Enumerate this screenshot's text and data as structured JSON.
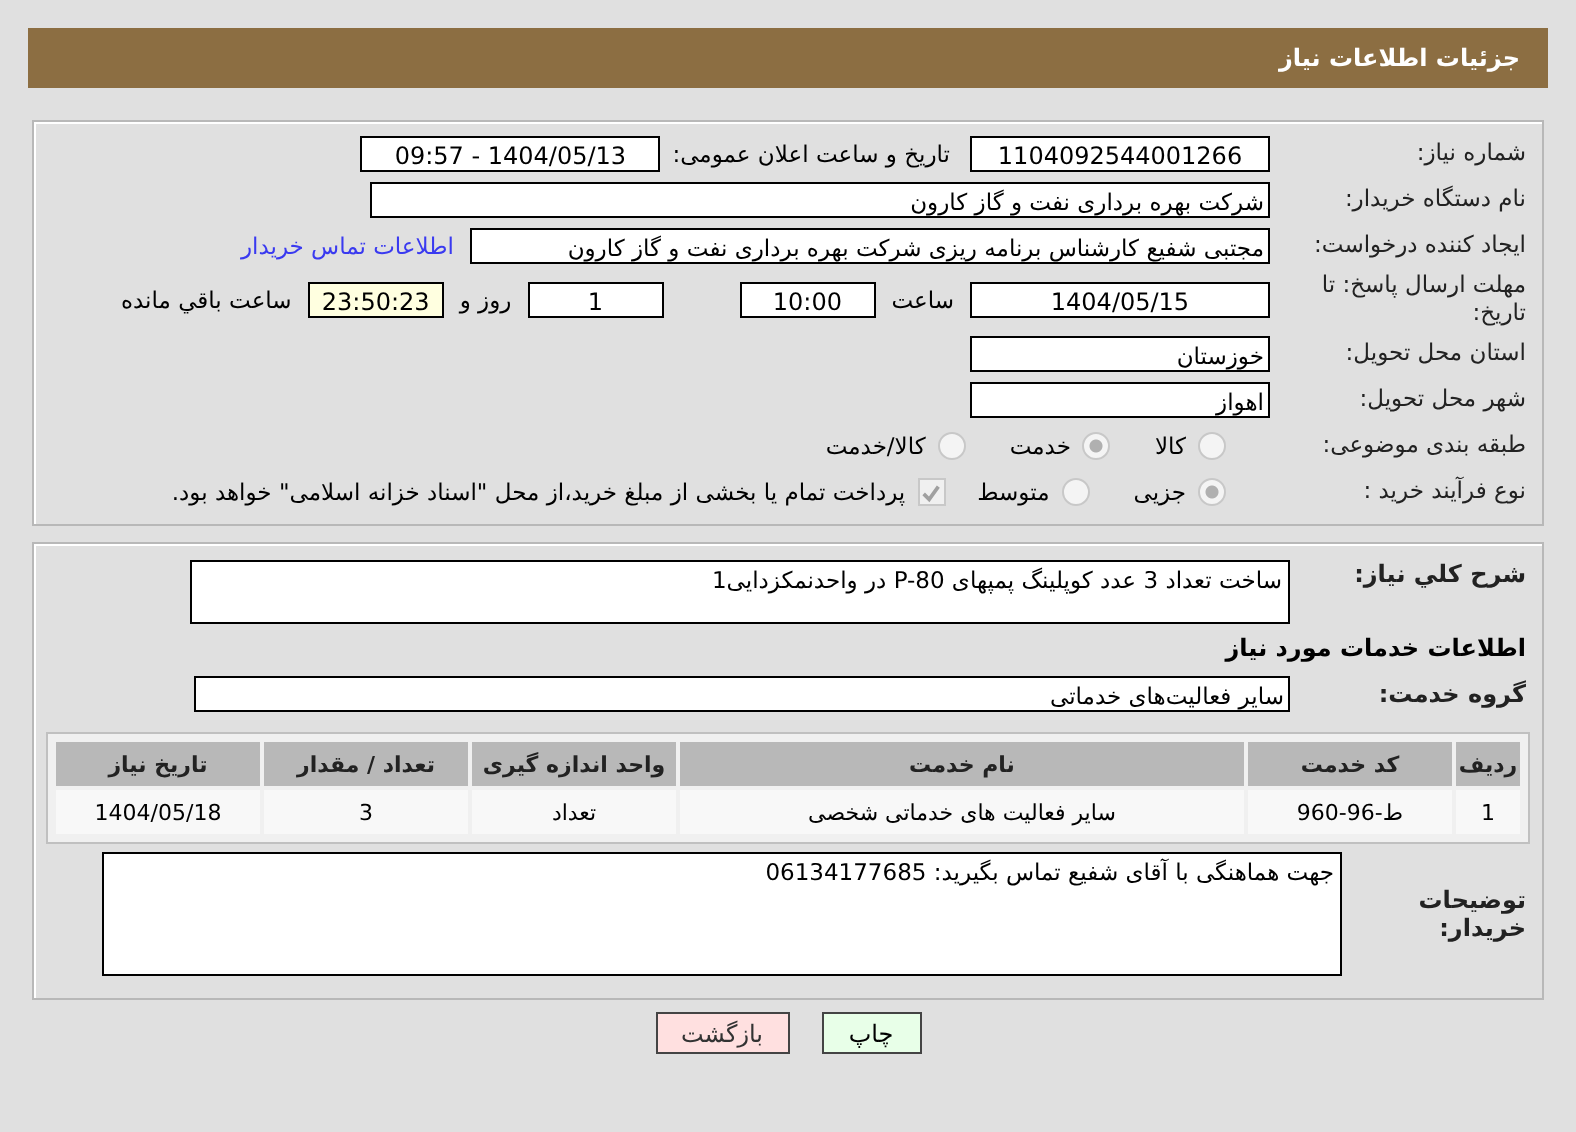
{
  "header": {
    "title": "جزئیات اطلاعات نیاز"
  },
  "need_number": {
    "label": "شماره نیاز:",
    "value": "1104092544001266"
  },
  "announce": {
    "label": "تاریخ و ساعت اعلان عمومی:",
    "value": "1404/05/13 - 09:57"
  },
  "buyer": {
    "label": "نام دستگاه خریدار:",
    "value": "شرکت بهره برداری نفت و گاز کارون"
  },
  "requester": {
    "label": "ایجاد کننده درخواست:",
    "value": "مجتبی شفیع کارشناس برنامه ریزی شرکت بهره برداری نفت و گاز کارون",
    "link": "اطلاعات تماس خریدار"
  },
  "deadline": {
    "label": "مهلت ارسال پاسخ: تا تاریخ:",
    "date": "1404/05/15",
    "time_label": "ساعت",
    "time": "10:00",
    "days": "1",
    "days_label": "روز و",
    "remaining": "23:50:23",
    "remaining_label": "ساعت باقي مانده"
  },
  "province": {
    "label": "استان محل تحویل:",
    "value": "خوزستان"
  },
  "city": {
    "label": "شهر محل تحویل:",
    "value": "اهواز"
  },
  "category": {
    "label": "طبقه بندی موضوعی:",
    "options": [
      {
        "label": "کالا",
        "selected": false
      },
      {
        "label": "خدمت",
        "selected": true
      },
      {
        "label": "کالا/خدمت",
        "selected": false
      }
    ]
  },
  "process": {
    "label": "نوع فرآیند خرید :",
    "options": [
      {
        "label": "جزیی",
        "selected": true
      },
      {
        "label": "متوسط",
        "selected": false
      }
    ],
    "treasury": {
      "label": "پرداخت تمام یا بخشی از مبلغ خرید،از محل \"اسناد خزانه اسلامی\" خواهد بود.",
      "checked": true
    }
  },
  "description": {
    "label": "شرح کلي نياز:",
    "value": "ساخت تعداد 3 عدد کوپلینگ پمپهای P-80 در واحدنمکزدایی1"
  },
  "services_title": "اطلاعات خدمات مورد نياز",
  "service_group": {
    "label": "گروه خدمت:",
    "value": "سایر فعالیت‌های خدماتی"
  },
  "table": {
    "columns": [
      "ردیف",
      "کد خدمت",
      "نام خدمت",
      "واحد اندازه گیری",
      "تعداد / مقدار",
      "تاریخ نیاز"
    ],
    "rows": [
      [
        "1",
        "ط-96-960",
        "سایر فعالیت های خدماتی شخصی",
        "تعداد",
        "3",
        "1404/05/18"
      ]
    ]
  },
  "buyer_notes": {
    "label": "توضیحات خریدار:",
    "value": "جهت هماهنگی با آقای شفیع تماس بگیرید: 06134177685"
  },
  "buttons": [
    {
      "label": "چاپ",
      "kind": "print"
    },
    {
      "label": "بازگشت",
      "kind": "back"
    }
  ]
}
